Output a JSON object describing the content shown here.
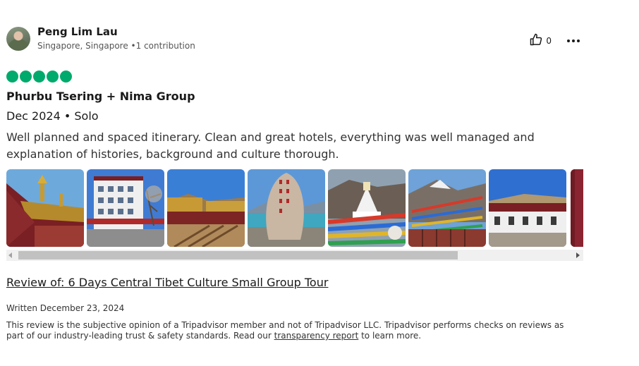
{
  "user": {
    "name": "Peng Lim Lau",
    "location": "Singapore, Singapore",
    "separator": "•",
    "contributions": "1 contribution",
    "avatar_icon": "user-photo-avatar"
  },
  "actions": {
    "helpful_icon": "thumbs-up-icon",
    "helpful_count": "0",
    "more_icon": "more-options-icon"
  },
  "rating": {
    "value": 5,
    "max": 5,
    "color": "#00aa6c"
  },
  "review": {
    "title": "Phurbu Tsering + Nima Group",
    "trip": "Dec 2024 • Solo",
    "text": "Well planned and spaced itinerary. Clean and great hotels, everything was well managed and explanation of histories, background and culture thorough."
  },
  "photos": [
    {
      "subject": "golden temple roof"
    },
    {
      "subject": "white building street"
    },
    {
      "subject": "monastery rooftop"
    },
    {
      "subject": "carved stone by lake"
    },
    {
      "subject": "stupa with prayer flags"
    },
    {
      "subject": "mountain prayer flags"
    },
    {
      "subject": "red and white monastery"
    },
    {
      "subject": "red wall"
    }
  ],
  "review_of": {
    "prefix": "Review of:",
    "tour": "6 Days Central Tibet Culture Small Group Tour"
  },
  "written": "Written December 23, 2024",
  "disclaimer": {
    "text_before": "This review is the subjective opinion of a Tripadvisor member and not of Tripadvisor LLC. Tripadvisor performs checks on reviews as part of our industry-leading trust & safety standards. Read our ",
    "link": "transparency report",
    "text_after": " to learn more."
  }
}
